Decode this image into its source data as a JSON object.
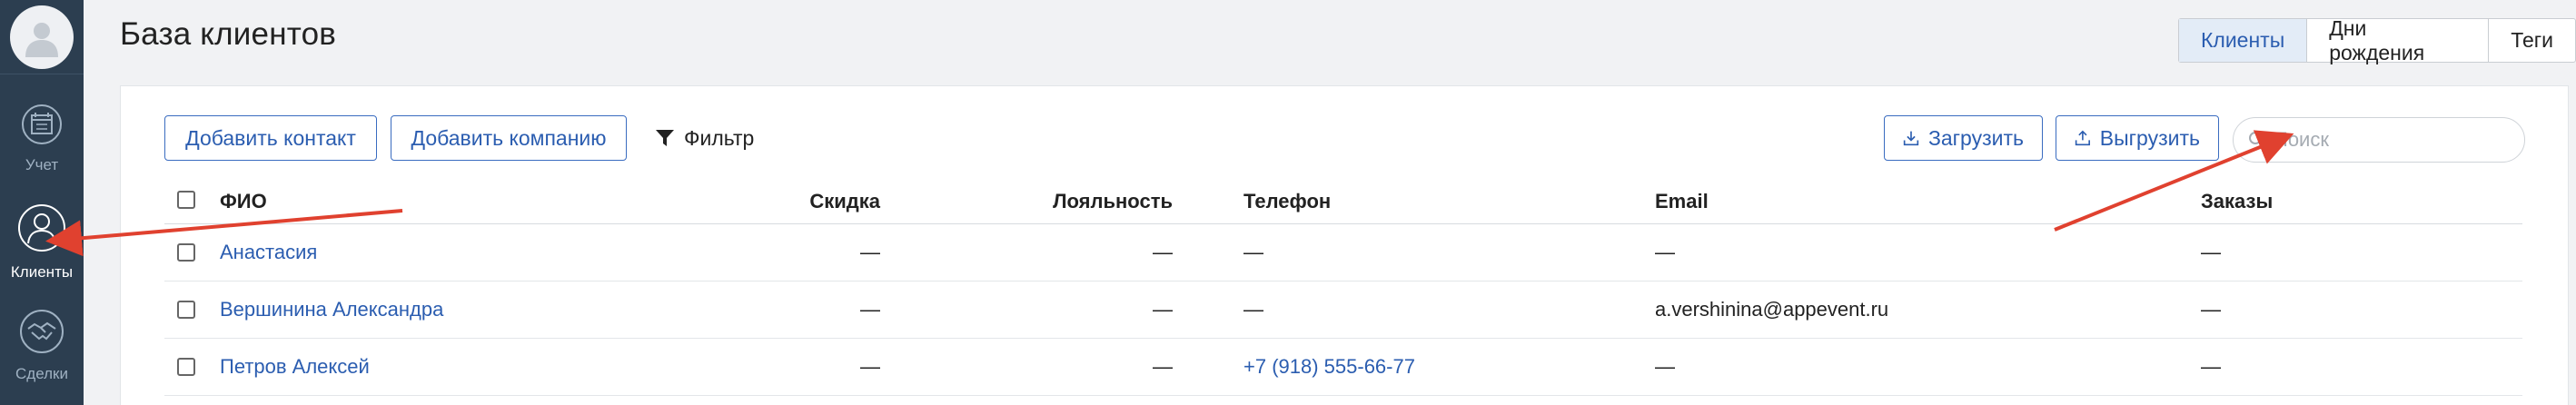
{
  "sidebar": {
    "items": [
      {
        "label": "Учет",
        "icon": "calendar-icon",
        "active": false
      },
      {
        "label": "Клиенты",
        "icon": "user-icon",
        "active": true
      },
      {
        "label": "Сделки",
        "icon": "handshake-icon",
        "active": false
      }
    ]
  },
  "header": {
    "title": "База клиентов",
    "tabs": [
      {
        "label": "Клиенты",
        "active": true
      },
      {
        "label": "Дни рождения",
        "active": false
      },
      {
        "label": "Теги",
        "active": false
      }
    ]
  },
  "toolbar": {
    "add_contact": "Добавить контакт",
    "add_company": "Добавить компанию",
    "filter": "Фильтр",
    "upload": "Загрузить",
    "download": "Выгрузить",
    "search_placeholder": "Поиск"
  },
  "table": {
    "columns": {
      "name": "ФИО",
      "discount": "Скидка",
      "loyalty": "Лояльность",
      "phone": "Телефон",
      "email": "Email",
      "orders": "Заказы"
    },
    "rows": [
      {
        "name": "Анастасия",
        "discount": "—",
        "loyalty": "—",
        "phone": "—",
        "email": "—",
        "orders": "—"
      },
      {
        "name": "Вершинина Александра",
        "discount": "—",
        "loyalty": "—",
        "phone": "—",
        "email": "a.vershinina@appevent.ru",
        "orders": "—"
      },
      {
        "name": "Петров Алексей",
        "discount": "—",
        "loyalty": "—",
        "phone": "+7 (918) 555-66-77",
        "email": "—",
        "orders": "—"
      }
    ]
  },
  "colors": {
    "sidebar_bg": "#2c3e50",
    "accent": "#2b5db0",
    "annotation_arrow": "#e0412f"
  }
}
